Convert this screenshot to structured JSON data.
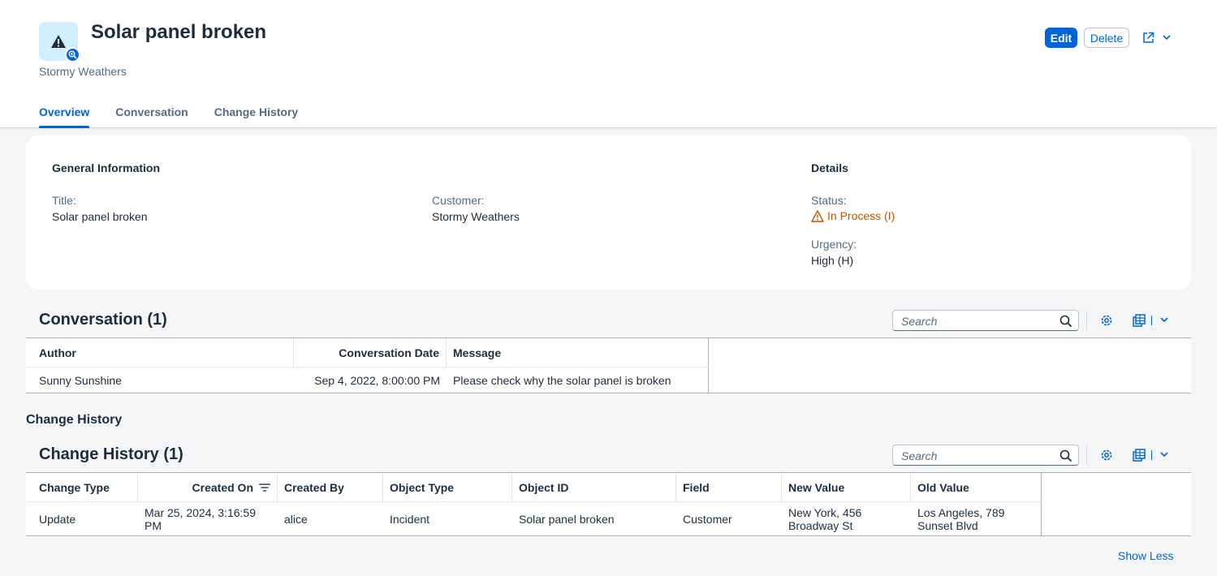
{
  "header": {
    "title": "Solar panel broken",
    "subtitle": "Stormy Weathers",
    "edit_label": "Edit",
    "delete_label": "Delete",
    "icon": "warning-icon",
    "badge_icon": "zoom-icon"
  },
  "tabs": [
    {
      "label": "Overview",
      "active": true
    },
    {
      "label": "Conversation",
      "active": false
    },
    {
      "label": "Change History",
      "active": false
    }
  ],
  "general": {
    "heading": "General Information",
    "title_label": "Title:",
    "title_value": "Solar panel broken",
    "customer_label": "Customer:",
    "customer_value": "Stormy Weathers"
  },
  "details": {
    "heading": "Details",
    "status_label": "Status:",
    "status_value": "In Process (I)",
    "urgency_label": "Urgency:",
    "urgency_value": "High (H)"
  },
  "conversation": {
    "title": "Conversation (1)",
    "search_placeholder": "Search",
    "columns": [
      "Author",
      "Conversation Date",
      "Message"
    ],
    "rows": [
      [
        "Sunny Sunshine",
        "Sep 4, 2022, 8:00:00 PM",
        "Please check why the solar panel is broken"
      ]
    ]
  },
  "change_history": {
    "section_label": "Change History",
    "title": "Change History (1)",
    "search_placeholder": "Search",
    "columns": [
      "Change Type",
      "Created On",
      "Created By",
      "Object Type",
      "Object ID",
      "Field",
      "New Value",
      "Old Value"
    ],
    "rows": [
      [
        "Update",
        "Mar 25, 2024, 3:16:59 PM",
        "alice",
        "Incident",
        "Solar panel broken",
        "Customer",
        "New York, 456 Broadway St",
        "Los Angeles, 789 Sunset Blvd"
      ]
    ],
    "show_less": "Show Less"
  },
  "colors": {
    "accent": "#0064d9",
    "status_warning": "#c35500"
  }
}
